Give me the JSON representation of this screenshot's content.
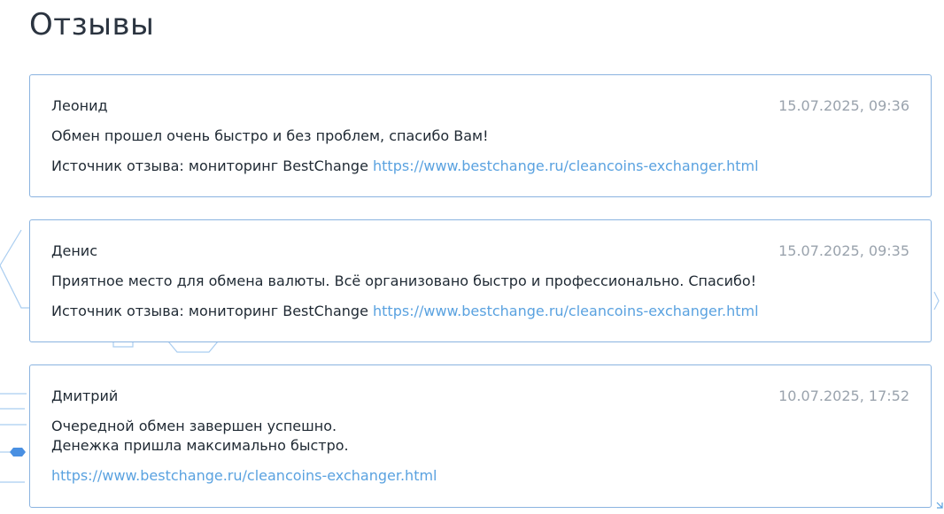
{
  "page": {
    "title": "Отзывы"
  },
  "colors": {
    "card_border": "#8ab3e0",
    "link": "#5aa2e0",
    "date": "#9aa3ad",
    "decor": "#a9cdf0"
  },
  "reviews": [
    {
      "author": "Леонид",
      "date": "15.07.2025, 09:36",
      "text": "Обмен прошел очень быстро и без проблем, спасибо Вам!",
      "source_label": "Источник отзыва: мониторинг BestChange",
      "link": "https://www.bestchange.ru/cleancoins-exchanger.html"
    },
    {
      "author": "Денис",
      "date": "15.07.2025, 09:35",
      "text": "Приятное место для обмена валюты. Всё организовано быстро и профессионально. Спасибо!",
      "source_label": "Источник отзыва: мониторинг BestChange",
      "link": "https://www.bestchange.ru/cleancoins-exchanger.html"
    },
    {
      "author": "Дмитрий",
      "date": "10.07.2025, 17:52",
      "text": "Очередной обмен завершен успешно.\nДенежка пришла максимально быстро.",
      "link": "https://www.bestchange.ru/cleancoins-exchanger.html"
    }
  ]
}
